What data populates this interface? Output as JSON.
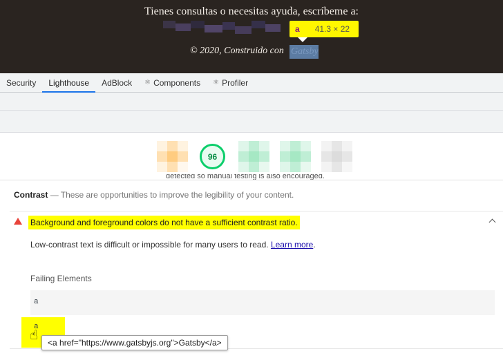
{
  "page": {
    "contact_text": "Tienes consultas o necesitas ayuda, escríbeme a:",
    "copyright_text": "© 2020, Construido con",
    "gatsby_link_text": "Gatsby"
  },
  "inspector_tooltip": {
    "tag": "a",
    "dimensions": "41.3 × 22"
  },
  "devtools": {
    "tabs": [
      {
        "label": "Security",
        "icon": ""
      },
      {
        "label": "Lighthouse",
        "icon": ""
      },
      {
        "label": "AdBlock",
        "icon": ""
      },
      {
        "label": "Components",
        "icon": "gear-icon"
      },
      {
        "label": "Profiler",
        "icon": "gear-icon"
      }
    ],
    "active_tab": "Lighthouse"
  },
  "lighthouse": {
    "score": "96",
    "clipped_text": "detected so manual testing is also encouraged.",
    "section_title": "Contrast",
    "section_description": "— These are opportunities to improve the legibility of your content.",
    "audit_title": "Background and foreground colors do not have a sufficient contrast ratio.",
    "audit_description": "Low-contrast text is difficult or impossible for many users to read.",
    "learn_more": "Learn more",
    "failing_label": "Failing Elements",
    "failing_element": "a",
    "node_preview": "a",
    "node_tooltip": "<a href=\"https://www.gatsbyjs.org\">Gatsby</a>"
  },
  "colors": {
    "footer_bg": "#2a2420",
    "highlight": "#ffff00",
    "pass_green": "#0cce6b",
    "fail_red": "#e8433b",
    "accent_blue": "#1a73e8"
  }
}
